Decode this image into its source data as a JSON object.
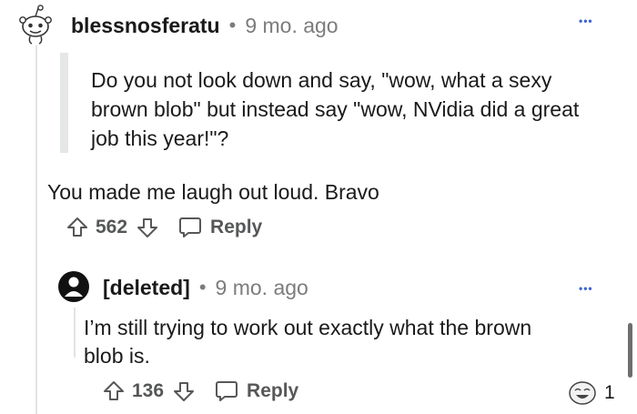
{
  "comment1": {
    "username": "blessnosferatu",
    "separator": "•",
    "time": "9 mo. ago",
    "more": "•••",
    "quote": "Do you not look down and say, \"wow, what a sexy brown blob\" but instead say \"wow, NVidia did a great job this year!\"?",
    "body": "You made me laugh out loud. Bravo",
    "votes": "562",
    "reply_label": "Reply"
  },
  "comment2": {
    "username": "[deleted]",
    "separator": "•",
    "time": "9 mo. ago",
    "more": "•••",
    "body": "I’m still trying to work out exactly what the brown blob is.",
    "votes": "136",
    "reply_label": "Reply"
  },
  "award": {
    "icon": "laughing-face-award-icon",
    "count": "1"
  },
  "colors": {
    "text": "#1a1a1b",
    "meta": "#7c7c7c",
    "accent": "#3e63d6",
    "action": "#565758"
  }
}
